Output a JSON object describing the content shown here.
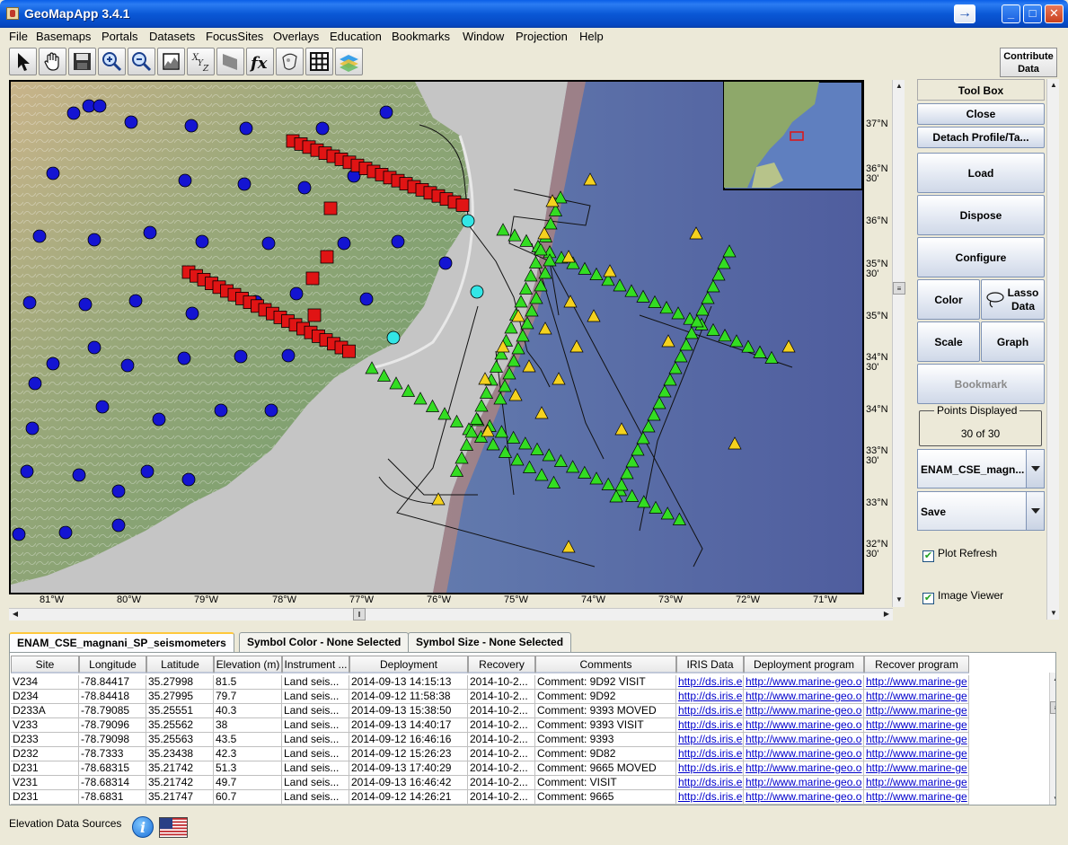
{
  "window": {
    "title": "GeoMapApp 3.4.1"
  },
  "menu": [
    "File",
    "Basemaps",
    "Portals",
    "Datasets",
    "FocusSites",
    "Overlays",
    "Education",
    "Bookmarks",
    "Window",
    "Projection",
    "Help"
  ],
  "toolbar": {
    "tools": [
      "select-arrow-icon",
      "pan-hand-icon",
      "save-disk-icon",
      "zoom-in-icon",
      "zoom-out-icon",
      "chart-frame-icon",
      "xyz-icon",
      "shade-icon",
      "function-icon",
      "palette-icon",
      "grid-icon",
      "layers-icon"
    ],
    "contribute_label": "Contribute Data",
    "fx_label": "fx",
    "xyz_label": "XYZ"
  },
  "map": {
    "lat_labels": [
      {
        "text": "37°N"
      },
      {
        "text": "36°N 30'"
      },
      {
        "text": "36°N"
      },
      {
        "text": "35°N 30'"
      },
      {
        "text": "35°N"
      },
      {
        "text": "34°N 30'"
      },
      {
        "text": "34°N"
      },
      {
        "text": "33°N 30'"
      },
      {
        "text": "33°N"
      },
      {
        "text": "32°N 30'"
      }
    ],
    "lon_labels": [
      "81°W",
      "80°W",
      "79°W",
      "78°W",
      "77°W",
      "76°W",
      "75°W",
      "74°W",
      "73°W",
      "72°W",
      "71°W"
    ],
    "colors": {
      "land_symbol": "#1414d2",
      "land_square": "#e01414",
      "cyan_symbol": "#33e6e6",
      "obs_green": "#33dd22",
      "obs_yellow": "#f5d21e",
      "ocean": "#5a6aa8"
    }
  },
  "toolbox": {
    "title": "Tool Box",
    "close": "Close",
    "detach": "Detach Profile/Ta...",
    "load": "Load",
    "dispose": "Dispose",
    "configure": "Configure",
    "color": "Color",
    "lasso": "Lasso Data",
    "scale": "Scale",
    "graph": "Graph",
    "bookmark": "Bookmark",
    "points_legend": "Points Displayed",
    "points_value": "30 of 30",
    "dataset_select": "ENAM_CSE_magn...",
    "save_select": "Save",
    "plot_refresh": "Plot Refresh",
    "image_viewer": "Image Viewer"
  },
  "tabs": [
    {
      "label": "ENAM_CSE_magnani_SP_seismometers",
      "active": true
    },
    {
      "label": "Symbol Color - None Selected",
      "active": false
    },
    {
      "label": "Symbol Size - None Selected",
      "active": false
    }
  ],
  "table": {
    "columns": [
      "Site",
      "Longitude",
      "Latitude",
      "Elevation (m)",
      "Instrument ...",
      "Deployment",
      "Recovery",
      "Comments",
      "IRIS Data",
      "Deployment program",
      "Recover program"
    ],
    "rows": [
      [
        "V234",
        "-78.84417",
        "35.27998",
        "81.5",
        "Land seis...",
        "2014-09-13 14:15:13",
        "2014-10-2...",
        "Comment: 9D92 VISIT",
        "http://ds.iris.e",
        "http://www.marine-geo.o",
        "http://www.marine-ge"
      ],
      [
        "D234",
        "-78.84418",
        "35.27995",
        "79.7",
        "Land seis...",
        "2014-09-12 11:58:38",
        "2014-10-2...",
        "Comment: 9D92",
        "http://ds.iris.e",
        "http://www.marine-geo.o",
        "http://www.marine-ge"
      ],
      [
        "D233A",
        "-78.79085",
        "35.25551",
        "40.3",
        "Land seis...",
        "2014-09-13 15:38:50",
        "2014-10-2...",
        "Comment: 9393 MOVED",
        "http://ds.iris.e",
        "http://www.marine-geo.o",
        "http://www.marine-ge"
      ],
      [
        "V233",
        "-78.79096",
        "35.25562",
        "38",
        "Land seis...",
        "2014-09-13 14:40:17",
        "2014-10-2...",
        "Comment: 9393 VISIT",
        "http://ds.iris.e",
        "http://www.marine-geo.o",
        "http://www.marine-ge"
      ],
      [
        "D233",
        "-78.79098",
        "35.25563",
        "43.5",
        "Land seis...",
        "2014-09-12 16:46:16",
        "2014-10-2...",
        "Comment: 9393",
        "http://ds.iris.e",
        "http://www.marine-geo.o",
        "http://www.marine-ge"
      ],
      [
        "D232",
        "-78.7333",
        "35.23438",
        "42.3",
        "Land seis...",
        "2014-09-12 15:26:23",
        "2014-10-2...",
        "Comment: 9D82",
        "http://ds.iris.e",
        "http://www.marine-geo.o",
        "http://www.marine-ge"
      ],
      [
        "D231",
        "-78.68315",
        "35.21742",
        "51.3",
        "Land seis...",
        "2014-09-13 17:40:29",
        "2014-10-2...",
        "Comment: 9665 MOVED",
        "http://ds.iris.e",
        "http://www.marine-geo.o",
        "http://www.marine-ge"
      ],
      [
        "V231",
        "-78.68314",
        "35.21742",
        "49.7",
        "Land seis...",
        "2014-09-13 16:46:42",
        "2014-10-2...",
        "Comment: VISIT",
        "http://ds.iris.e",
        "http://www.marine-geo.o",
        "http://www.marine-ge"
      ],
      [
        "D231",
        "-78.6831",
        "35.21747",
        "60.7",
        "Land seis...",
        "2014-09-12 14:26:21",
        "2014-10-2...",
        "Comment: 9665",
        "http://ds.iris.e",
        "http://www.marine-geo.o",
        "http://www.marine-ge"
      ]
    ]
  },
  "footer": {
    "label": "Elevation Data Sources"
  }
}
